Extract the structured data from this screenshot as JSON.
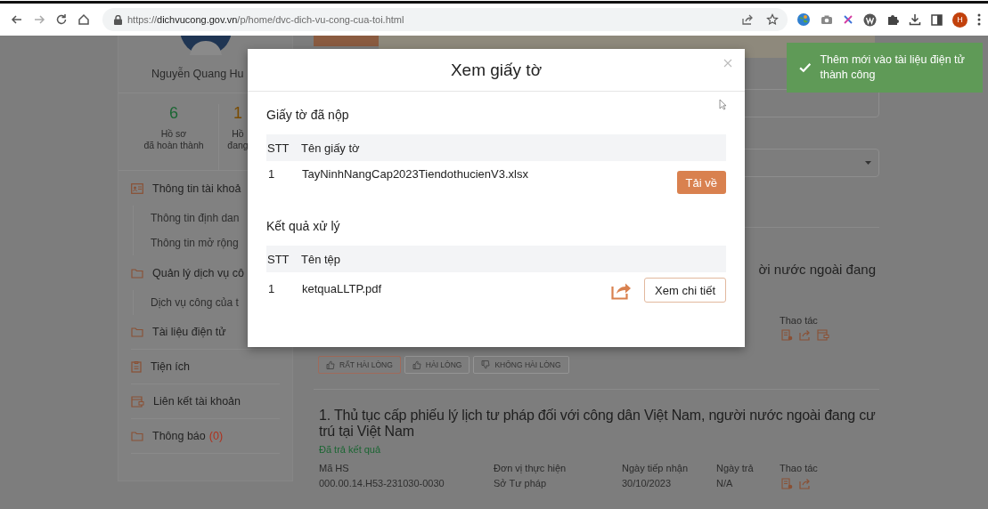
{
  "browser": {
    "url": "https://**dichvucong.gov.vn**/p/home/dvc-dich-vu-cong-cua-toi.html",
    "profile_initial": "H"
  },
  "sidebar": {
    "user_name": "Nguyễn Quang Hu",
    "stats": [
      {
        "value": "6",
        "label_lines": [
          "Hồ sơ",
          "đã hoàn thành"
        ],
        "color": "#1b6633"
      },
      {
        "value": "1",
        "label_lines": [
          "Hồ",
          "đang"
        ],
        "color": "#7a4c00"
      }
    ],
    "menu": [
      {
        "kind": "section",
        "label": "Thông tin tài khoả"
      },
      {
        "kind": "sub",
        "label": "Thông tin định dan"
      },
      {
        "kind": "sub",
        "label": "Thông tin mở rộng"
      },
      {
        "kind": "section",
        "label": "Quản lý dịch vụ cô"
      },
      {
        "kind": "sub",
        "label": "Dịch vụ công của t"
      },
      {
        "kind": "section",
        "label": "Tài liệu điện tử"
      },
      {
        "kind": "section",
        "label": "Tiện ích"
      },
      {
        "kind": "section",
        "label": "Liên kết tài khoản"
      },
      {
        "kind": "section",
        "label": "Thông báo",
        "count": "(0)"
      }
    ]
  },
  "main": {
    "heading_fragment": "ời nước ngoài đang",
    "actions_label": "Thao tác",
    "ratings": [
      {
        "label": "RẤT HÀI LÒNG",
        "selected": true
      },
      {
        "label": "HÀI LÒNG",
        "selected": false
      },
      {
        "label": "KHÔNG HÀI LÒNG",
        "selected": false
      }
    ],
    "record": {
      "title": "1. Thủ tục cấp phiếu lý lịch tư pháp đối với công dân Việt Nam, người nước ngoài đang cư trú tại Việt Nam",
      "status": "Đã trả kết quả",
      "fields": [
        {
          "kind": "text",
          "label": "Mã HS",
          "value": "000.00.14.H53-231030-0030"
        },
        {
          "kind": "text",
          "label": "Đơn vị thực hiện",
          "value": "Sở Tư pháp"
        },
        {
          "kind": "text",
          "label": "Ngày tiếp nhận",
          "value": "30/10/2023"
        },
        {
          "kind": "text",
          "label": "Ngày trả",
          "value": "N/A"
        },
        {
          "kind": "actions",
          "label": "Thao tác"
        }
      ]
    }
  },
  "modal": {
    "title": "Xem giấy tờ",
    "sections": [
      {
        "heading": "Giấy tờ đã nộp",
        "columns": [
          "STT",
          "Tên giấy tờ"
        ],
        "rows": [
          {
            "kind": "download",
            "index": "1",
            "name": "TayNinhNangCap2023TiendothucienV3.xlsx",
            "action": "Tải về"
          }
        ]
      },
      {
        "heading": "Kết quả xử lý",
        "columns": [
          "STT",
          "Tên tệp"
        ],
        "rows": [
          {
            "kind": "share-detail",
            "index": "1",
            "name": "ketquaLLTP.pdf",
            "action": "Xem chi tiết"
          }
        ]
      }
    ]
  },
  "toast": {
    "message": "Thêm mới vào tài liệu điện tử thành công"
  }
}
